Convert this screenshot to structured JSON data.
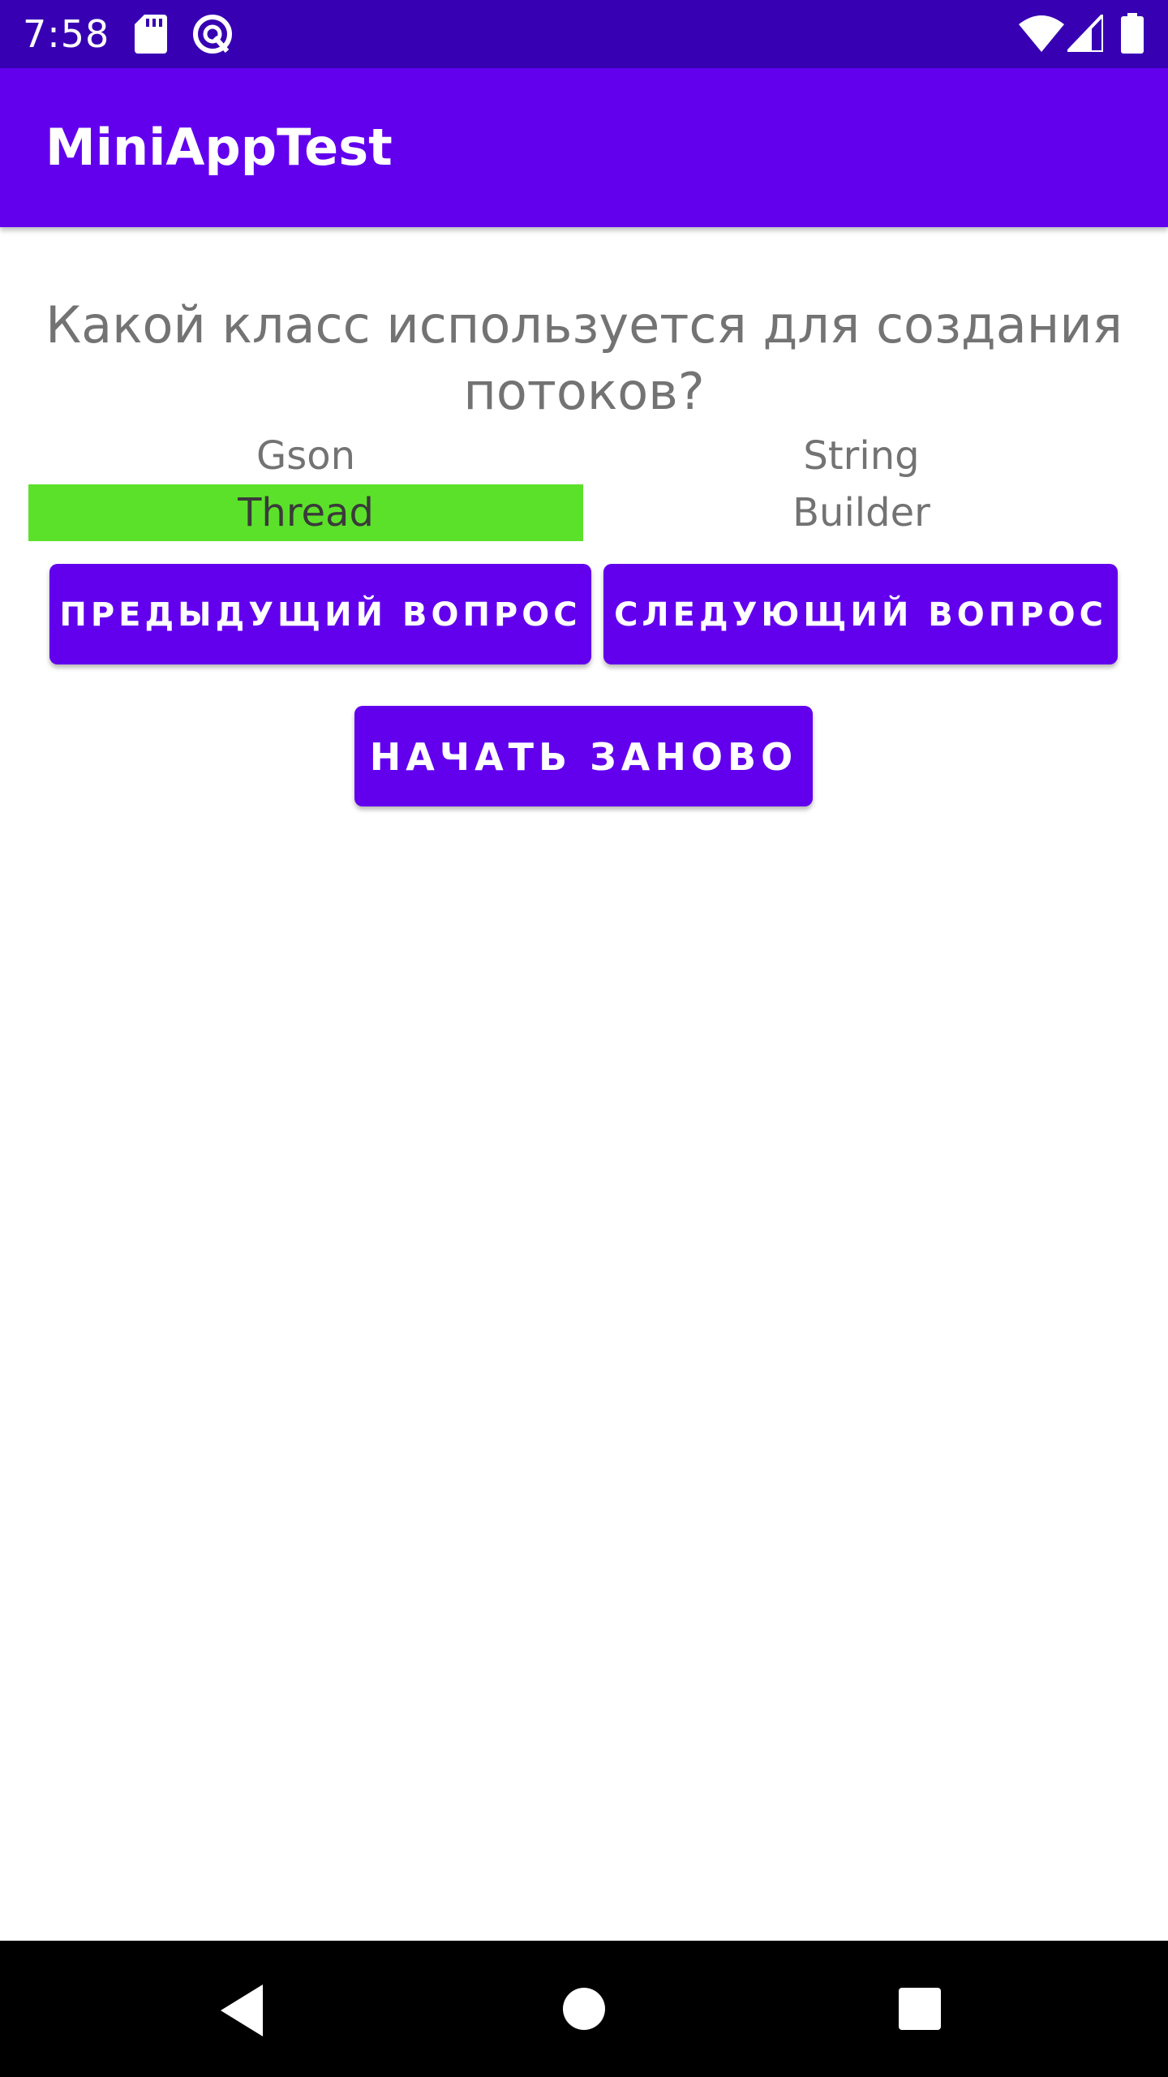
{
  "status_bar": {
    "time": "7:58",
    "icons": [
      "sd-card-icon",
      "sync-icon",
      "wifi-icon",
      "signal-icon",
      "battery-icon"
    ]
  },
  "app_bar": {
    "title": "MiniAppTest"
  },
  "quiz": {
    "question": "Какой класс используется для создания потоков?",
    "answers": [
      {
        "text": "Gson",
        "correct": false
      },
      {
        "text": "String",
        "correct": false
      },
      {
        "text": "Thread",
        "correct": true
      },
      {
        "text": "Builder",
        "correct": false
      }
    ],
    "prev_label": "ПРЕДЫДУЩИЙ ВОПРОС",
    "next_label": "СЛЕДУЮЩИЙ ВОПРОС",
    "restart_label": "НАЧАТЬ ЗАНОВО"
  },
  "nav_bar": {
    "icons": [
      "back-icon",
      "home-icon",
      "recent-apps-icon"
    ]
  },
  "colors": {
    "status_bar": "#3700B3",
    "primary": "#6200EE",
    "correct_answer": "#5CE12A",
    "text_secondary": "#737373"
  }
}
